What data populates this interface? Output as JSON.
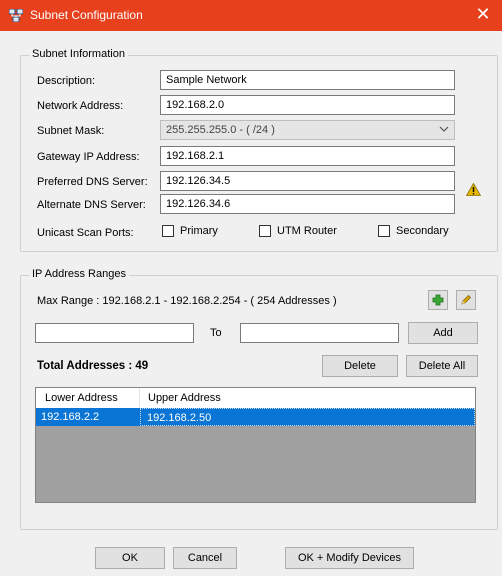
{
  "window": {
    "title": "Subnet Configuration",
    "close_glyph": "✕",
    "icon": "network-icon"
  },
  "subnet_info": {
    "legend": "Subnet Information",
    "description_label": "Description:",
    "description_value": "Sample Network",
    "network_label": "Network Address:",
    "network_value": "192.168.2.0",
    "mask_label": "Subnet Mask:",
    "mask_value": "255.255.255.0 - ( /24 )",
    "gateway_label": "Gateway IP Address:",
    "gateway_value": "192.168.2.1",
    "pref_dns_label": "Preferred DNS Server:",
    "pref_dns_value": "192.126.34.5",
    "alt_dns_label": "Alternate DNS Server:",
    "alt_dns_value": "192.126.34.6",
    "ports_label": "Unicast Scan Ports:",
    "ports": [
      {
        "label": "Primary",
        "checked": false
      },
      {
        "label": "UTM Router",
        "checked": false
      },
      {
        "label": "Secondary",
        "checked": false
      }
    ]
  },
  "ranges": {
    "legend": "IP Address Ranges",
    "max_range": "Max Range : 192.168.2.1 - 192.168.2.254 - ( 254 Addresses )",
    "from_value": "",
    "to_label": "To",
    "to_value": "",
    "add_label": "Add",
    "total": "Total Addresses : 49",
    "delete_label": "Delete",
    "delete_all_label": "Delete All",
    "columns": [
      "Lower Address",
      "Upper Address"
    ],
    "rows": [
      {
        "lower": "192.168.2.2",
        "upper": "192.168.2.50",
        "selected": true
      }
    ]
  },
  "footer": {
    "ok_label": "OK",
    "cancel_label": "Cancel",
    "ok_modify_label": "OK + Modify Devices"
  },
  "colors": {
    "titlebar": "#e6401d",
    "selection": "#0a75d4",
    "warning": "#e6b800",
    "add_icon": "#3aa935",
    "edit_icon": "#e0a800"
  }
}
